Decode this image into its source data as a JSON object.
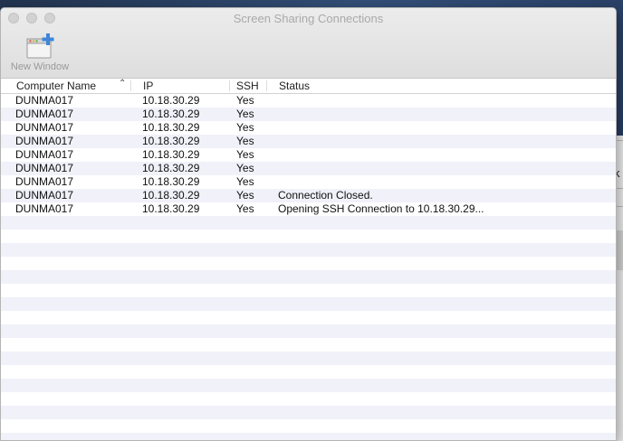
{
  "window": {
    "title": "Screen Sharing Connections"
  },
  "toolbar": {
    "new_window_label": "New Window"
  },
  "background": {
    "glyph": "k"
  },
  "table": {
    "columns": [
      {
        "key": "name",
        "label": "Computer Name",
        "sorted": "ascending"
      },
      {
        "key": "ip",
        "label": "IP"
      },
      {
        "key": "ssh",
        "label": "SSH"
      },
      {
        "key": "status",
        "label": "Status"
      }
    ],
    "rows": [
      {
        "name": "DUNMA017",
        "ip": "10.18.30.29",
        "ssh": "Yes",
        "status": ""
      },
      {
        "name": "DUNMA017",
        "ip": "10.18.30.29",
        "ssh": "Yes",
        "status": ""
      },
      {
        "name": "DUNMA017",
        "ip": "10.18.30.29",
        "ssh": "Yes",
        "status": ""
      },
      {
        "name": "DUNMA017",
        "ip": "10.18.30.29",
        "ssh": "Yes",
        "status": ""
      },
      {
        "name": "DUNMA017",
        "ip": "10.18.30.29",
        "ssh": "Yes",
        "status": ""
      },
      {
        "name": "DUNMA017",
        "ip": "10.18.30.29",
        "ssh": "Yes",
        "status": ""
      },
      {
        "name": "DUNMA017",
        "ip": "10.18.30.29",
        "ssh": "Yes",
        "status": ""
      },
      {
        "name": "DUNMA017",
        "ip": "10.18.30.29",
        "ssh": "Yes",
        "status": "Connection Closed."
      },
      {
        "name": "DUNMA017",
        "ip": "10.18.30.29",
        "ssh": "Yes",
        "status": "Opening SSH Connection to 10.18.30.29..."
      }
    ]
  }
}
